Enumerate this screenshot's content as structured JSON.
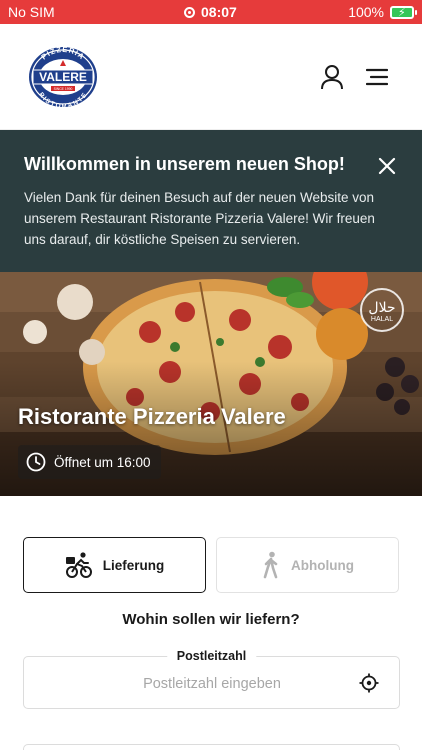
{
  "status_bar": {
    "carrier": "No SIM",
    "time": "08:07",
    "battery": "100%",
    "battery_level": 1.0
  },
  "header": {
    "logo": {
      "top_text": "PIZZERIA",
      "main_text": "VALERE",
      "bottom_text": "RISTORANTE",
      "ribbon_text": "SINCE 1990"
    },
    "icons": [
      "user-icon",
      "menu-icon"
    ]
  },
  "welcome": {
    "title": "Willkommen in unserem neuen Shop!",
    "text": "Vielen Dank für deinen Besuch auf der neuen Website von unserem Restaurant Ristorante Pizzeria Valere! Wir freuen uns darauf, dir köstliche Speisen zu servieren.",
    "close_icon": "close-icon"
  },
  "hero": {
    "restaurant_name": "Ristorante Pizzeria Valere",
    "opening_hours": "Öffnet um 16:00",
    "badge_arabic": "حلال",
    "badge_text": "HALAL"
  },
  "order": {
    "modes": [
      {
        "label": "Lieferung",
        "icon": "bicycle-icon",
        "active": true
      },
      {
        "label": "Abholung",
        "icon": "walking-icon",
        "active": false
      }
    ],
    "question": "Wohin sollen wir liefern?",
    "postcode": {
      "label": "Postleitzahl",
      "placeholder": "Postleitzahl eingeben",
      "value": ""
    }
  },
  "colors": {
    "status_bar": "#e63b3b",
    "banner": "#2b3d3f",
    "logo_blue": "#1f3f8c",
    "logo_red": "#d42b2b"
  }
}
